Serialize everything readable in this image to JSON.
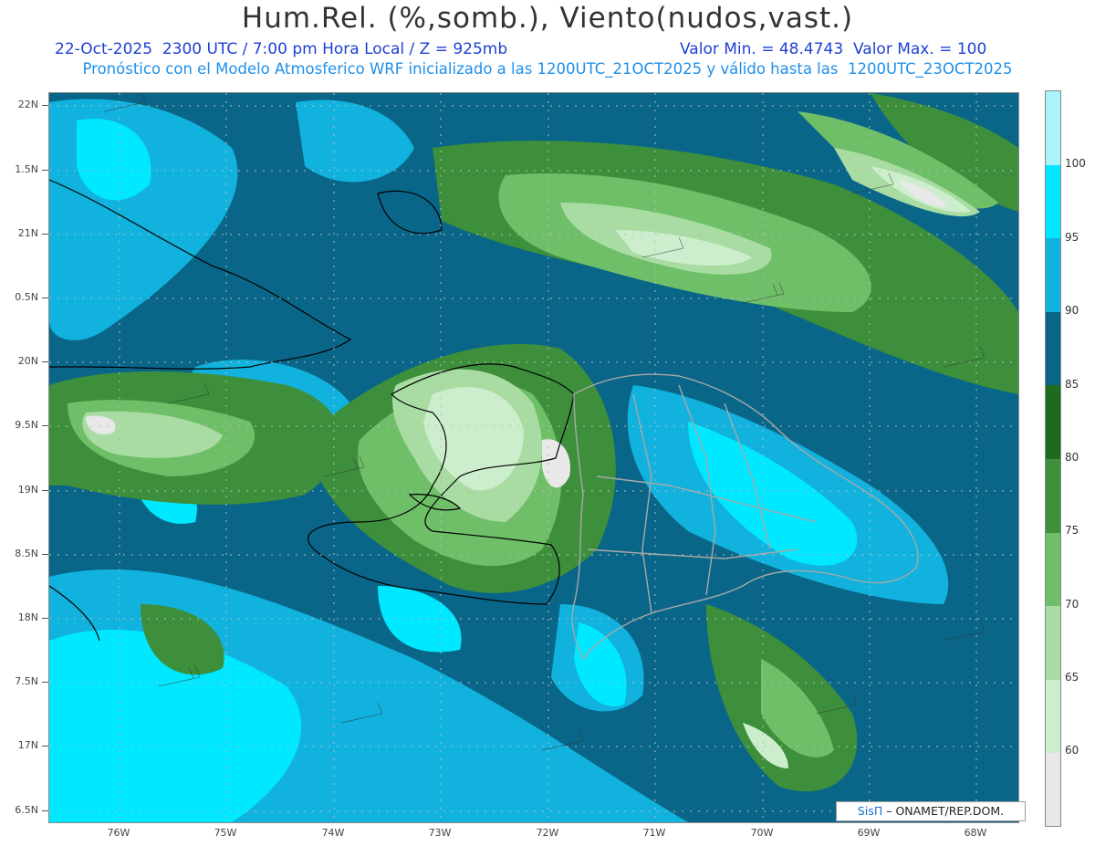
{
  "title": "Hum.Rel. (%,somb.), Viento(nudos,vast.)",
  "subtitle": {
    "datetime": "22-Oct-2025  2300 UTC / 7:00 pm Hora Local / Z = 925mb",
    "minmax": "Valor Min. = 48.4743  Valor Max. = 100",
    "model": "Pronóstico con el Modelo Atmosferico WRF inicializado a las 1200UTC_21OCT2025 y válido hasta las  1200UTC_23OCT2025"
  },
  "axes": {
    "lat_labels": [
      "22N",
      "1.5N",
      "21N",
      "0.5N",
      "20N",
      "9.5N",
      "19N",
      "8.5N",
      "18N",
      "7.5N",
      "17N",
      "6.5N"
    ],
    "lat_values": [
      22,
      21.5,
      21,
      20.5,
      20,
      19.5,
      19,
      18.5,
      18,
      17.5,
      17,
      16.5
    ],
    "lon_labels": [
      "76W",
      "75W",
      "74W",
      "73W",
      "72W",
      "71W",
      "70W",
      "69W",
      "68W"
    ],
    "lon_values": [
      -76,
      -75,
      -74,
      -73,
      -72,
      -71,
      -70,
      -69,
      -68
    ],
    "lon_range": [
      -76.65,
      -67.6
    ],
    "lat_range": [
      16.45,
      22.12
    ]
  },
  "colorbar": {
    "levels": [
      "60",
      "65",
      "70",
      "75",
      "80",
      "85",
      "90",
      "95",
      "100"
    ],
    "colors": [
      "#e8e8e8",
      "#cdeecd",
      "#a8dca2",
      "#6fbf69",
      "#3d8f3c",
      "#1e6b1f",
      "#0a6688",
      "#11b2dd",
      "#00e8ff",
      "#a8f4fa"
    ]
  },
  "credits": {
    "brand": "SisΠ",
    "org": "– ONAMET/REP.DOM."
  }
}
